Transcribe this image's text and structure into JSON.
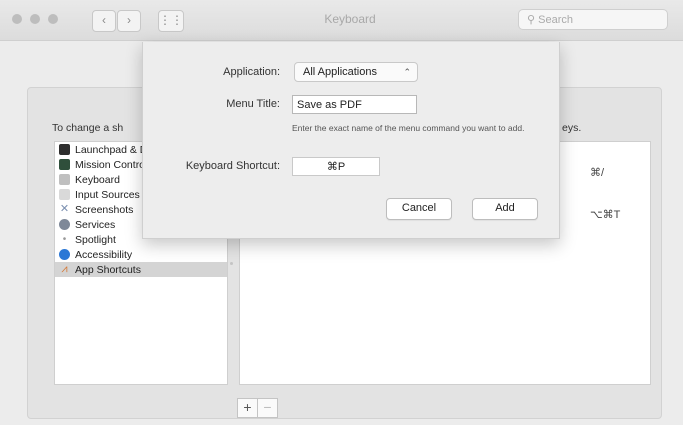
{
  "window": {
    "title": "Keyboard",
    "search_placeholder": "Search",
    "back_glyph": "‹",
    "forward_glyph": "›",
    "grid_glyph": "⋮⋮"
  },
  "instructions": {
    "left": "To change a sh",
    "right": "eys."
  },
  "sidebar": {
    "items": [
      {
        "label": "Launchpad & Dock",
        "icon": "launchpad-icon"
      },
      {
        "label": "Mission Control",
        "icon": "mission-control-icon"
      },
      {
        "label": "Keyboard",
        "icon": "keyboard-icon"
      },
      {
        "label": "Input Sources",
        "icon": "input-sources-icon"
      },
      {
        "label": "Screenshots",
        "icon": "screenshots-icon"
      },
      {
        "label": "Services",
        "icon": "services-icon"
      },
      {
        "label": "Spotlight",
        "icon": "spotlight-icon"
      },
      {
        "label": "Accessibility",
        "icon": "accessibility-icon"
      },
      {
        "label": "App Shortcuts",
        "icon": "app-shortcuts-icon",
        "selected": true
      }
    ]
  },
  "shortcuts": {
    "row1": "⌘/",
    "row2": "⌥⌘T"
  },
  "sheet": {
    "application_label": "Application:",
    "application_value": "All Applications",
    "menu_title_label": "Menu Title:",
    "menu_title_value": "Save as PDF",
    "hint": "Enter the exact name of the menu command you want to add.",
    "keyboard_shortcut_label": "Keyboard Shortcut:",
    "keyboard_shortcut_value": "⌘P",
    "cancel_label": "Cancel",
    "add_label": "Add"
  },
  "buttons": {
    "plus": "+",
    "minus": "−"
  }
}
